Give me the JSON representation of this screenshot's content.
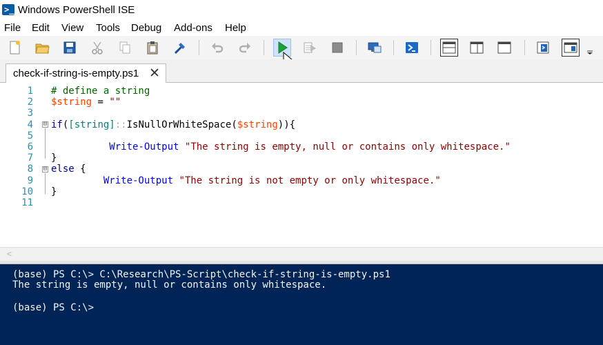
{
  "window": {
    "title": "Windows PowerShell ISE",
    "app_icon_glyph": ">_"
  },
  "menu": [
    "File",
    "Edit",
    "View",
    "Tools",
    "Debug",
    "Add-ons",
    "Help"
  ],
  "toolbar": {
    "icons": [
      "new-file-icon",
      "open-folder-icon",
      "save-icon",
      "cut-icon",
      "copy-icon",
      "paste-icon",
      "clear-console-icon",
      "undo-icon",
      "redo-icon",
      "run-script-icon",
      "run-selection-icon",
      "stop-icon",
      "new-remote-tab-icon",
      "start-powershell-icon",
      "script-pane-top-icon",
      "script-pane-right-icon",
      "script-pane-maximized-icon",
      "show-command-icon",
      "show-command-addon-icon",
      "toolbar-overflow-icon"
    ]
  },
  "tab": {
    "label": "check-if-string-is-empty.ps1",
    "close": "✕"
  },
  "editor": {
    "line_numbers": [
      "1",
      "2",
      "3",
      "4",
      "5",
      "6",
      "7",
      "8",
      "9",
      "10",
      "11"
    ],
    "lines": [
      [
        {
          "t": "# define a string",
          "c": "c-comment"
        }
      ],
      [
        {
          "t": "$string",
          "c": "c-var"
        },
        {
          "t": " = ",
          "c": "c-plain"
        },
        {
          "t": "\"\"",
          "c": "c-str"
        }
      ],
      [],
      [
        {
          "t": "if",
          "c": "c-kw"
        },
        {
          "t": "(",
          "c": "c-plain"
        },
        {
          "t": "[string]",
          "c": "c-type"
        },
        {
          "t": "::",
          "c": "c-op"
        },
        {
          "t": "IsNullOrWhiteSpace",
          "c": "c-plain"
        },
        {
          "t": "(",
          "c": "c-plain"
        },
        {
          "t": "$string",
          "c": "c-var"
        },
        {
          "t": ")){",
          "c": "c-plain"
        }
      ],
      [],
      [
        {
          "t": "          ",
          "c": "c-plain"
        },
        {
          "t": "Write-Output",
          "c": "c-cmd"
        },
        {
          "t": " ",
          "c": "c-plain"
        },
        {
          "t": "\"The string is empty, null or contains only whitespace.\"",
          "c": "c-str"
        }
      ],
      [
        {
          "t": "}",
          "c": "c-plain"
        }
      ],
      [
        {
          "t": "else",
          "c": "c-kw"
        },
        {
          "t": " {",
          "c": "c-plain"
        }
      ],
      [
        {
          "t": "         ",
          "c": "c-plain"
        },
        {
          "t": "Write-Output",
          "c": "c-cmd"
        },
        {
          "t": " ",
          "c": "c-plain"
        },
        {
          "t": "\"The string is not empty or only whitespace.\"",
          "c": "c-str"
        }
      ],
      [
        {
          "t": "}",
          "c": "c-plain"
        }
      ],
      []
    ],
    "fold_markers": [
      "⊟",
      "⊟"
    ]
  },
  "hscroll": {
    "arrow": "<"
  },
  "console": {
    "lines": [
      "(base) PS C:\\> C:\\Research\\PS-Script\\check-if-string-is-empty.ps1",
      "The string is empty, null or contains only whitespace.",
      "",
      "(base) PS C:\\>"
    ]
  },
  "colors": {
    "console_bg": "#012456",
    "comment": "#006400",
    "variable": "#ff4500",
    "string": "#8b0000",
    "keyword": "#00008b",
    "type": "#008080",
    "command": "#0000ff",
    "line_number": "#2b91af"
  }
}
